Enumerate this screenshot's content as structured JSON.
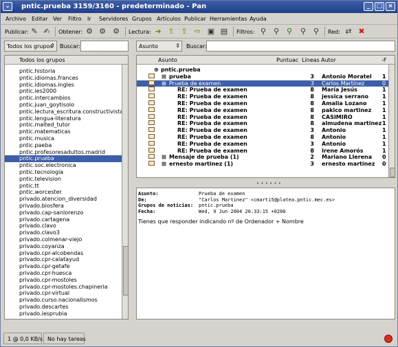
{
  "window": {
    "title": "pntic.prueba 3159/3160 - predeterminado - Pan"
  },
  "menu": [
    "Archivo",
    "Editar",
    "Ver",
    "Filtro",
    "Ir",
    "Servidores",
    "Grupos",
    "Artículos",
    "Publicar",
    "Herramientas",
    "Ayuda"
  ],
  "toolbar": {
    "publicar": "Publicar:",
    "obtener": "Obtener:",
    "lectura": "Lectura:",
    "filtros": "Filtros:",
    "red": "Red:"
  },
  "left": {
    "filter_value": "Todos los grupos",
    "search_label": "Buscar:",
    "column": "Todos los grupos",
    "groups": [
      "pntic.historia",
      "pntic.idiomas.frances",
      "pntic.idiomas.ingles",
      "pntic.ies2000",
      "pntic.intercambios",
      "pntic.juan_goytisolo",
      "pntic.lectura_escritura.constructivista",
      "pntic.lengua-literatura",
      "pntic.malted_tutor",
      "pntic.matematicas",
      "pntic.musica",
      "pntic.paeba",
      "pntic.profesoresadultos.madrid",
      "pntic.prueba",
      "pntic.soc.electronica",
      "pntic.tecnologia",
      "pntic.television",
      "pntic.tt",
      "pntic.worcester",
      "privado.atencion_diversidad",
      "privado.biosfera",
      "privado.cap-sanlorenzo",
      "privado.cartagena",
      "privado.clavo",
      "privado.clavo3",
      "privado.colmenar-viejo",
      "privado.coyanza",
      "privado.cpr-alcobendas",
      "privado.cpr-calatayud",
      "privado.cpr-getafe",
      "privado.cpr-huesca",
      "privado.cpr-mostoles",
      "privado.cpr-mostoles.chapineria",
      "privado.cpr-virtual",
      "privado.curso.nacionalismos",
      "privado.descartes",
      "privado.iesprubia"
    ],
    "selected_index": 13
  },
  "threads": {
    "filter_value": "Asunto",
    "search_label": "Buscar:",
    "columns": {
      "subject": "Asunto",
      "score": "Puntuac",
      "lines": "Líneas",
      "author": "Autor",
      "date": "-F"
    },
    "rows": [
      {
        "subject": "pntic.prueba",
        "lines": "",
        "author": "",
        "date": "",
        "indent": 0,
        "bold": true,
        "icon": "group-icon"
      },
      {
        "subject": "prueba",
        "lines": "3",
        "author": "Antonio Moratel",
        "date": "1",
        "indent": 1,
        "bold": true,
        "icon": "envelope-icon"
      },
      {
        "subject": "Prueba de examen",
        "lines": "3",
        "author": "Carlos Martínez",
        "date": "0",
        "indent": 1,
        "bold": false,
        "icon": "envelope-icon",
        "selected": true
      },
      {
        "subject": "RE: Prueba de examen",
        "lines": "8",
        "author": "María Jesús",
        "date": "1",
        "indent": 2,
        "bold": true,
        "icon": "envelope-icon"
      },
      {
        "subject": "RE: Prueba de examen",
        "lines": "8",
        "author": "jessica serrano",
        "date": "1",
        "indent": 2,
        "bold": true,
        "icon": "envelope-icon"
      },
      {
        "subject": "RE: Prueba de examen",
        "lines": "8",
        "author": "Amalia Lozano",
        "date": "1",
        "indent": 2,
        "bold": true,
        "icon": "envelope-icon"
      },
      {
        "subject": "RE: Prueba de examen",
        "lines": "8",
        "author": "pakico martinez",
        "date": "1",
        "indent": 2,
        "bold": true,
        "icon": "envelope-icon"
      },
      {
        "subject": "RE: Prueba de examen",
        "lines": "8",
        "author": "CASIMIRO",
        "date": "1",
        "indent": 2,
        "bold": true,
        "icon": "envelope-icon"
      },
      {
        "subject": "RE: Prueba de examen",
        "lines": "8",
        "author": "almudena martinez",
        "date": "1",
        "indent": 2,
        "bold": true,
        "icon": "envelope-icon"
      },
      {
        "subject": "RE: Prueba de examen",
        "lines": "3",
        "author": "Antonio",
        "date": "1",
        "indent": 2,
        "bold": true,
        "icon": "envelope-icon"
      },
      {
        "subject": "RE: Prueba de examen",
        "lines": "8",
        "author": "Antonio",
        "date": "1",
        "indent": 2,
        "bold": true,
        "icon": "envelope-icon"
      },
      {
        "subject": "RE: Prueba de examen",
        "lines": "3",
        "author": "Antonio",
        "date": "1",
        "indent": 2,
        "bold": true,
        "icon": "envelope-icon"
      },
      {
        "subject": "RE: Prueba de examen",
        "lines": "8",
        "author": "Irene Amorós",
        "date": "1",
        "indent": 2,
        "bold": true,
        "icon": "envelope-icon"
      },
      {
        "subject": "Mensaje de prueba (1)",
        "lines": "2",
        "author": "Mariano Llerena",
        "date": "0",
        "indent": 1,
        "bold": true,
        "icon": "envelope-icon"
      },
      {
        "subject": "ernesto martinez (1)",
        "lines": "3",
        "author": "ernesto martinez",
        "date": "0",
        "indent": 1,
        "bold": true,
        "icon": "envelope-icon"
      }
    ]
  },
  "message": {
    "subject_label": "Asunto:",
    "subject": "Prueba de examen",
    "from_label": "De:",
    "from": "\"Carlos Martínez\" <cmarti5@platea.pntic.mec.es>",
    "groups_label": "Grupos de noticias:",
    "groups": "pntic.prueba",
    "date_label": "Fecha:",
    "date": "Wed, 9 Jun 2004 20:33:15 +0200",
    "body": "Tienes que responder indicando nº de Ordenador + Nombre"
  },
  "status": {
    "speed": "1 @ 0,0 KB/s",
    "tasks": "No hay tareas"
  }
}
